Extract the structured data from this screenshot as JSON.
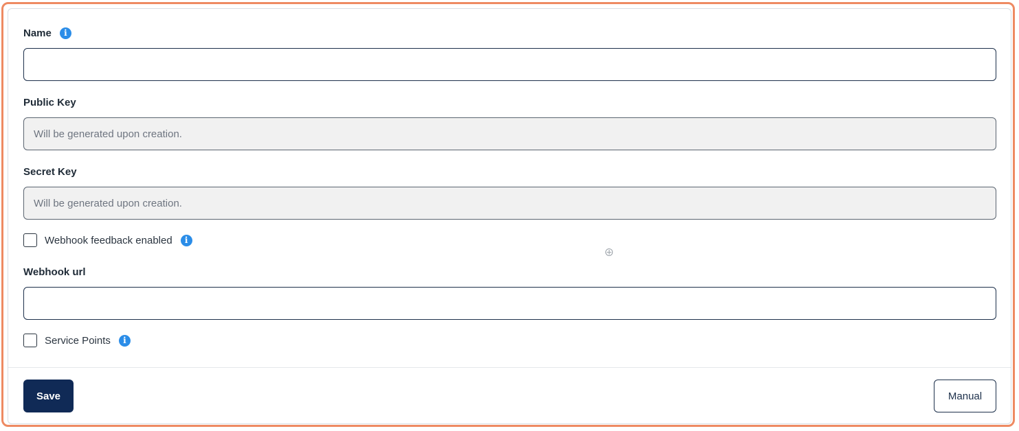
{
  "form": {
    "name_label": "Name",
    "name_value": "",
    "public_key_label": "Public Key",
    "public_key_placeholder": "Will be generated upon creation.",
    "secret_key_label": "Secret Key",
    "secret_key_placeholder": "Will be generated upon creation.",
    "webhook_feedback_label": "Webhook feedback enabled",
    "webhook_feedback_checked": false,
    "webhook_url_label": "Webhook url",
    "webhook_url_value": "",
    "service_points_label": "Service Points",
    "service_points_checked": false
  },
  "icons": {
    "info": "info-icon",
    "info_glyph": "i"
  },
  "footer": {
    "save_label": "Save",
    "manual_label": "Manual"
  },
  "colors": {
    "highlight_border": "#ee8a62",
    "primary": "#102a56",
    "info": "#2b8de8"
  }
}
